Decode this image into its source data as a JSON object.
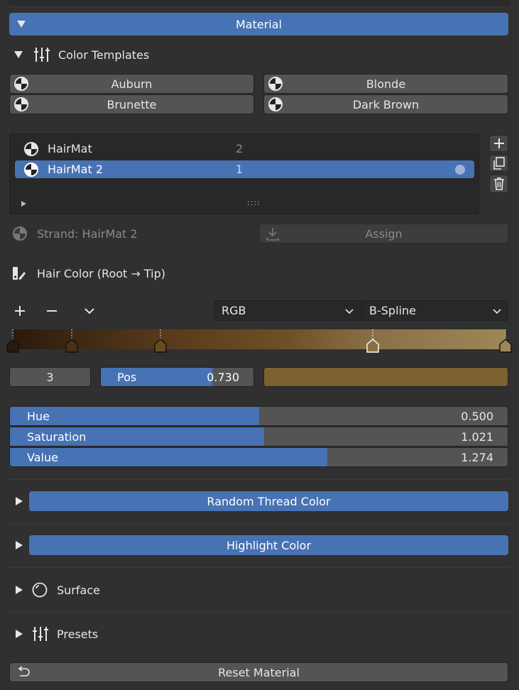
{
  "material_header": {
    "label": "Material"
  },
  "color_templates": {
    "title": "Color Templates",
    "buttons": [
      "Auburn",
      "Blonde",
      "Brunette",
      "Dark Brown"
    ]
  },
  "material_list": {
    "items": [
      {
        "name": "HairMat",
        "users": "2",
        "selected": false
      },
      {
        "name": "HairMat 2",
        "users": "1",
        "selected": true
      }
    ],
    "grip": "::::"
  },
  "strand": {
    "label": "Strand: HairMat 2",
    "assign_label": "Assign"
  },
  "hair_color": {
    "title": "Hair Color  (Root → Tip)",
    "color_mode": "RGB",
    "interpolation": "B-Spline",
    "stops": [
      {
        "pos": 0.0,
        "color": "#2a1a0d",
        "active": false
      },
      {
        "pos": 0.12,
        "color": "#4a3018",
        "active": false
      },
      {
        "pos": 0.3,
        "color": "#6a4a22",
        "active": false
      },
      {
        "pos": 0.73,
        "color": "#8a7047",
        "active": true
      },
      {
        "pos": 1.0,
        "color": "#9c8757",
        "active": false
      }
    ],
    "active_index": "3",
    "pos_label": "Pos",
    "pos_value": "0.730",
    "pos_fraction": 0.73,
    "active_color": "#7c6230"
  },
  "hsv": [
    {
      "label": "Hue",
      "value": "0.500",
      "fraction": 0.5
    },
    {
      "label": "Saturation",
      "value": "1.021",
      "fraction": 0.51
    },
    {
      "label": "Value",
      "value": "1.274",
      "fraction": 0.637
    }
  ],
  "panels": {
    "random_thread": "Random Thread Color",
    "highlight": "Highlight Color",
    "surface": "Surface",
    "presets": "Presets"
  },
  "reset": {
    "label": "Reset Material"
  },
  "colors": {
    "accent": "#4772b3",
    "button": "#545454",
    "background": "#303030"
  }
}
